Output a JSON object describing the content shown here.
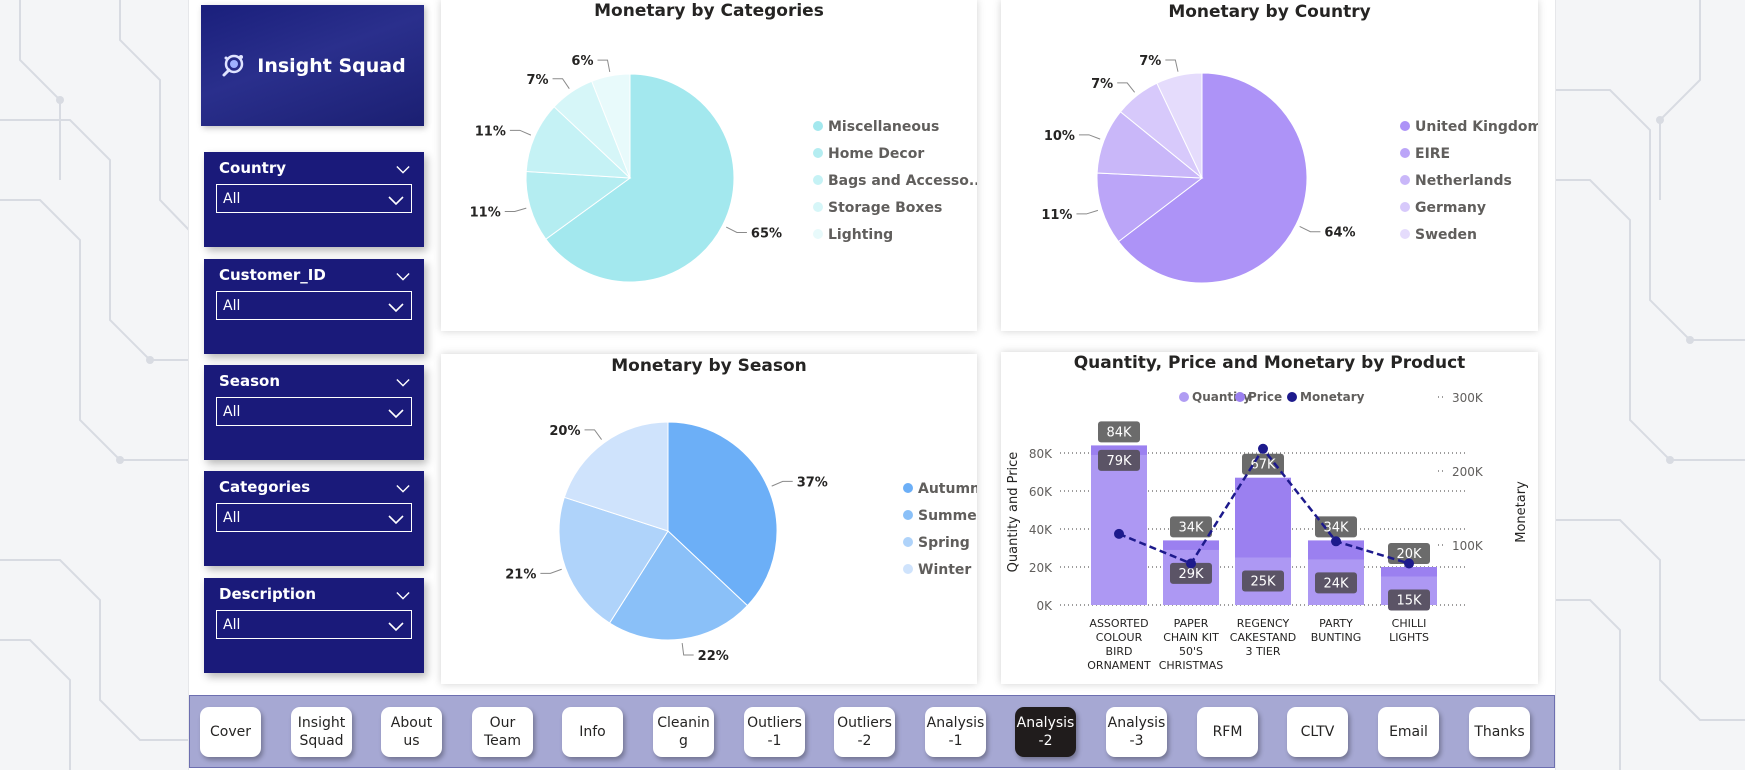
{
  "logo": {
    "text": "Insight Squad"
  },
  "slicers": [
    {
      "title": "Country",
      "value": "All"
    },
    {
      "title": "Customer_ID",
      "value": "All"
    },
    {
      "title": "Season",
      "value": "All"
    },
    {
      "title": "Categories",
      "value": "All"
    },
    {
      "title": "Description",
      "value": "All"
    }
  ],
  "nav": [
    {
      "label": "Cover",
      "active": false
    },
    {
      "label": "Insight\nSquad",
      "active": false
    },
    {
      "label": "About\nus",
      "active": false
    },
    {
      "label": "Our\nTeam",
      "active": false
    },
    {
      "label": "Info",
      "active": false
    },
    {
      "label": "Cleanin\ng",
      "active": false
    },
    {
      "label": "Outliers\n-1",
      "active": false
    },
    {
      "label": "Outliers\n-2",
      "active": false
    },
    {
      "label": "Analysis\n-1",
      "active": false
    },
    {
      "label": "Analysis\n-2",
      "active": true
    },
    {
      "label": "Analysis\n-3",
      "active": false
    },
    {
      "label": "RFM",
      "active": false
    },
    {
      "label": "CLTV",
      "active": false
    },
    {
      "label": "Email",
      "active": false
    },
    {
      "label": "Thanks",
      "active": false
    }
  ],
  "charts": {
    "categories": {
      "title": "Monetary by Categories"
    },
    "country": {
      "title": "Monetary by Country"
    },
    "season": {
      "title": "Monetary by Season"
    },
    "product": {
      "title": "Quantity, Price and Monetary by Product"
    }
  },
  "chart_data": [
    {
      "type": "pie",
      "title": "Monetary by Categories",
      "labels": [
        "Miscellaneous",
        "Home Decor",
        "Bags and Accesso...",
        "Storage Boxes",
        "Lighting"
      ],
      "values": [
        65,
        11,
        11,
        7,
        6
      ],
      "value_labels": [
        "65%",
        "11%",
        "11%",
        "7%",
        "6%"
      ],
      "colors": [
        "#a3e8ee",
        "#b4edf1",
        "#c5f2f5",
        "#d6f6f8",
        "#e8fafb"
      ],
      "legend": "right"
    },
    {
      "type": "pie",
      "title": "Monetary by Country",
      "labels": [
        "United Kingdom",
        "EIRE",
        "Netherlands",
        "Germany",
        "Sweden"
      ],
      "values": [
        64,
        11,
        10,
        7,
        7
      ],
      "value_labels": [
        "64%",
        "11%",
        "10%",
        "7%",
        "7%"
      ],
      "colors": [
        "#ad93f7",
        "#bba5f8",
        "#c9b7f9",
        "#d7c9fb",
        "#e5dcfc"
      ],
      "legend": "right"
    },
    {
      "type": "pie",
      "title": "Monetary by Season",
      "labels": [
        "Autumn",
        "Summer",
        "Spring",
        "Winter"
      ],
      "values": [
        37,
        22,
        21,
        20
      ],
      "value_labels": [
        "37%",
        "22%",
        "21%",
        "20%"
      ],
      "colors": [
        "#6caff7",
        "#8ac0f8",
        "#afd3fa",
        "#cfe3fc"
      ],
      "legend": "right"
    },
    {
      "type": "bar",
      "title": "Quantity, Price and Monetary by Product",
      "categories": [
        "ASSORTED\nCOLOUR\nBIRD\nORNAMENT",
        "PAPER\nCHAIN KIT\n50'S\nCHRISTMAS",
        "REGENCY\nCAKESTAND\n3 TIER",
        "PARTY\nBUNTING",
        "CHILLI\nLIGHTS"
      ],
      "series": [
        {
          "name": "Quantity",
          "kind": "bar",
          "axis": "left",
          "values": [
            79000,
            29000,
            25000,
            24000,
            15000
          ],
          "labels": [
            "79K",
            "29K",
            "25K",
            "24K",
            "15K"
          ],
          "color": "#b09cf3"
        },
        {
          "name": "Price",
          "kind": "bar",
          "axis": "left",
          "values": [
            84000,
            34000,
            67000,
            34000,
            20000
          ],
          "labels": [
            "84K",
            "34K",
            "67K",
            "34K",
            "20K"
          ],
          "color": "#9b80f0"
        },
        {
          "name": "Monetary",
          "kind": "line",
          "axis": "right",
          "values": [
            115000,
            75000,
            230000,
            105000,
            75000
          ],
          "color": "#1d1a8c"
        }
      ],
      "ylabel": "Quantity and Price",
      "y2label": "Monetary",
      "ylim": [
        0,
        80000
      ],
      "yticks": [
        "0K",
        "20K",
        "40K",
        "60K",
        "80K"
      ],
      "y2ticks": [
        "100K",
        "200K",
        "300K"
      ],
      "legend": "top"
    }
  ]
}
